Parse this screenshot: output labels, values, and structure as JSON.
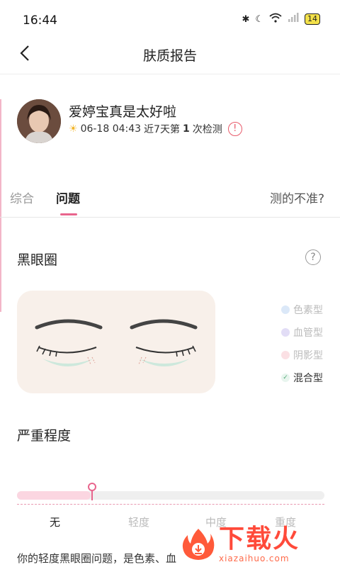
{
  "status": {
    "time": "16:44",
    "battery": "14"
  },
  "nav": {
    "title": "肤质报告"
  },
  "profile": {
    "username": "爱婷宝真是太好啦",
    "datetime": "06-18 04:43",
    "period_prefix": "近7天第",
    "count": "1",
    "count_suffix": "次检测"
  },
  "tabs": [
    {
      "label": "综合"
    },
    {
      "label": "问题"
    }
  ],
  "inaccurate_link": "测的不准?",
  "section": {
    "title": "黑眼圈",
    "legend": [
      {
        "label": "色素型",
        "color": "#dbe8f8"
      },
      {
        "label": "血管型",
        "color": "#e2ddf6"
      },
      {
        "label": "阴影型",
        "color": "#fbe0e4"
      },
      {
        "label": "混合型",
        "color": "#e8f5ee",
        "selected": true
      }
    ]
  },
  "severity": {
    "title": "严重程度",
    "levels": [
      "无",
      "轻度",
      "中度",
      "重度"
    ],
    "current_level": "轻度",
    "fill_fraction": 0.24
  },
  "description": "你的轻度黑眼圈问题，是色素、血",
  "watermark": {
    "cn": "下载火",
    "en": "xiazaihuo.com"
  },
  "colors": {
    "accent": "#e8658d",
    "alert": "#e85a6a",
    "watermark": "#ff4a3a"
  }
}
